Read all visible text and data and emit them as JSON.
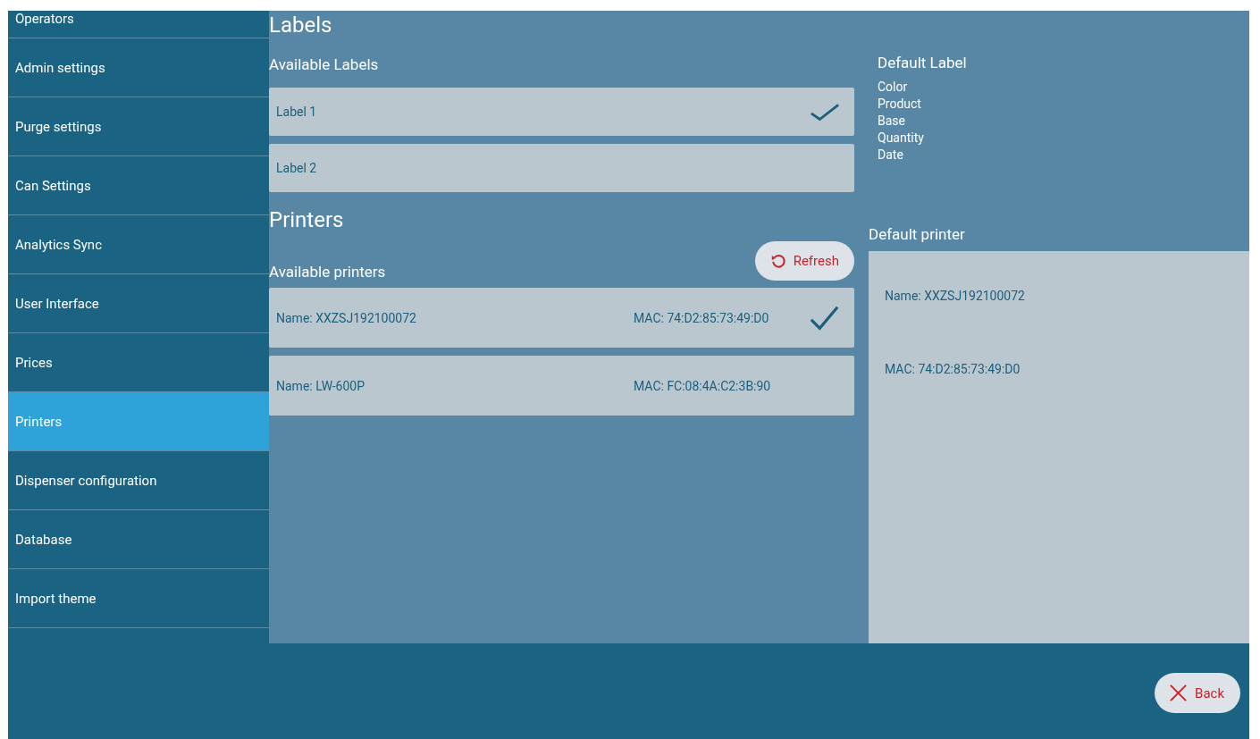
{
  "sidebar": {
    "items": [
      {
        "label": "Operators",
        "selected": false
      },
      {
        "label": "Admin settings",
        "selected": false
      },
      {
        "label": "Purge settings",
        "selected": false
      },
      {
        "label": "Can Settings",
        "selected": false
      },
      {
        "label": "Analytics Sync",
        "selected": false
      },
      {
        "label": "User Interface",
        "selected": false
      },
      {
        "label": "Prices",
        "selected": false
      },
      {
        "label": "Printers",
        "selected": true
      },
      {
        "label": "Dispenser configuration",
        "selected": false
      },
      {
        "label": "Database",
        "selected": false
      },
      {
        "label": "Import theme",
        "selected": false
      }
    ]
  },
  "labels": {
    "title": "Labels",
    "available_title": "Available Labels",
    "items": [
      {
        "name": "Label 1",
        "selected": true
      },
      {
        "name": "Label 2",
        "selected": false
      }
    ],
    "default_title": "Default Label",
    "default_fields": [
      "Color",
      "Product",
      "Base",
      "Quantity",
      "Date"
    ]
  },
  "printers": {
    "title": "Printers",
    "available_title": "Available printers",
    "refresh_button": "Refresh",
    "items": [
      {
        "name": "Name: XXZSJ192100072",
        "mac": "MAC: 74:D2:85:73:49:D0",
        "selected": true
      },
      {
        "name": "Name: LW-600P",
        "mac": "MAC: FC:08:4A:C2:3B:90",
        "selected": false
      }
    ],
    "default_title": "Default printer",
    "default_name": "Name: XXZSJ192100072",
    "default_mac": "MAC: 74:D2:85:73:49:D0"
  },
  "footer": {
    "back_button": "Back"
  }
}
